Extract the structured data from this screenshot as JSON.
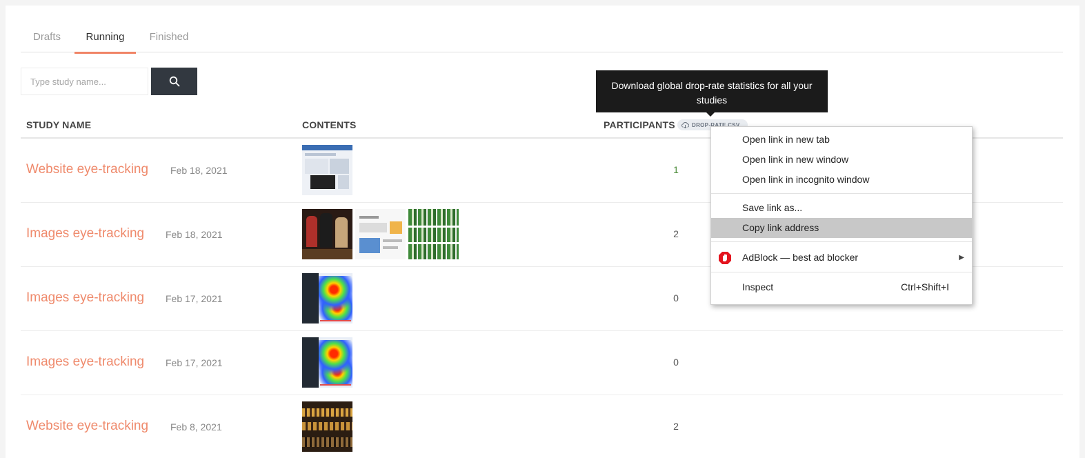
{
  "tabs": [
    {
      "label": "Drafts"
    },
    {
      "label": "Running"
    },
    {
      "label": "Finished"
    }
  ],
  "active_tab": "Running",
  "search": {
    "placeholder": "Type study name...",
    "value": ""
  },
  "table": {
    "headers": {
      "study_name": "STUDY NAME",
      "contents": "CONTENTS",
      "participants": "PARTICIPANTS"
    },
    "badge_label": "DROP-RATE CSV",
    "rows": [
      {
        "name": "Website eye-tracking",
        "date": "Feb 18, 2021",
        "participants": "1"
      },
      {
        "name": "Images eye-tracking",
        "date": "Feb 18, 2021",
        "participants": "2"
      },
      {
        "name": "Images eye-tracking",
        "date": "Feb 17, 2021",
        "participants": "0"
      },
      {
        "name": "Images eye-tracking",
        "date": "Feb 17, 2021",
        "participants": "0"
      },
      {
        "name": "Website eye-tracking",
        "date": "Feb 8, 2021",
        "participants": "2"
      }
    ]
  },
  "tooltip": {
    "text": "Download global drop-rate statistics for all your studies"
  },
  "context_menu": {
    "items": [
      {
        "label": "Open link in new tab"
      },
      {
        "label": "Open link in new window"
      },
      {
        "label": "Open link in incognito window"
      },
      {
        "label": "Save link as..."
      },
      {
        "label": "Copy link address"
      },
      {
        "label": "AdBlock — best ad blocker"
      },
      {
        "label": "Inspect",
        "shortcut": "Ctrl+Shift+I"
      }
    ]
  },
  "colors": {
    "accent": "#ef8a6c",
    "search_button": "#323840",
    "tooltip_bg": "#1b1b1b"
  },
  "icons": {
    "search": "search-icon",
    "download": "cloud-download-icon",
    "adblock": "adblock-hand-icon",
    "submenu": "chevron-right-icon"
  }
}
